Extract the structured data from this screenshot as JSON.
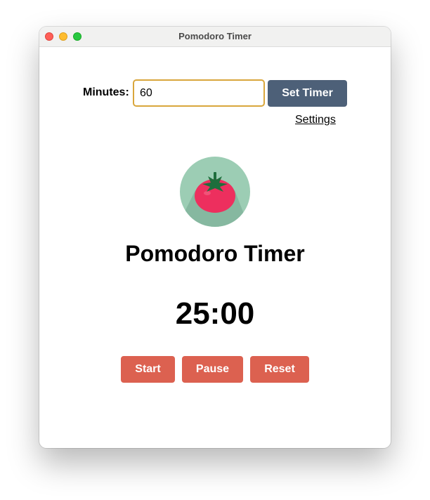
{
  "window": {
    "title": "Pomodoro Timer"
  },
  "form": {
    "minutes_label": "Minutes:",
    "minutes_value": "60",
    "set_timer_label": "Set Timer"
  },
  "settings_label": "Settings",
  "logo": {
    "icon": "tomato-icon"
  },
  "heading": "Pomodoro Timer",
  "timer": "25:00",
  "controls": {
    "start": "Start",
    "pause": "Pause",
    "reset": "Reset"
  },
  "colors": {
    "primary_button": "#4d6078",
    "control_button": "#dc6150",
    "input_border": "#d9a63c",
    "logo_circle": "#9ccdb4",
    "tomato": "#ed2f5e"
  }
}
